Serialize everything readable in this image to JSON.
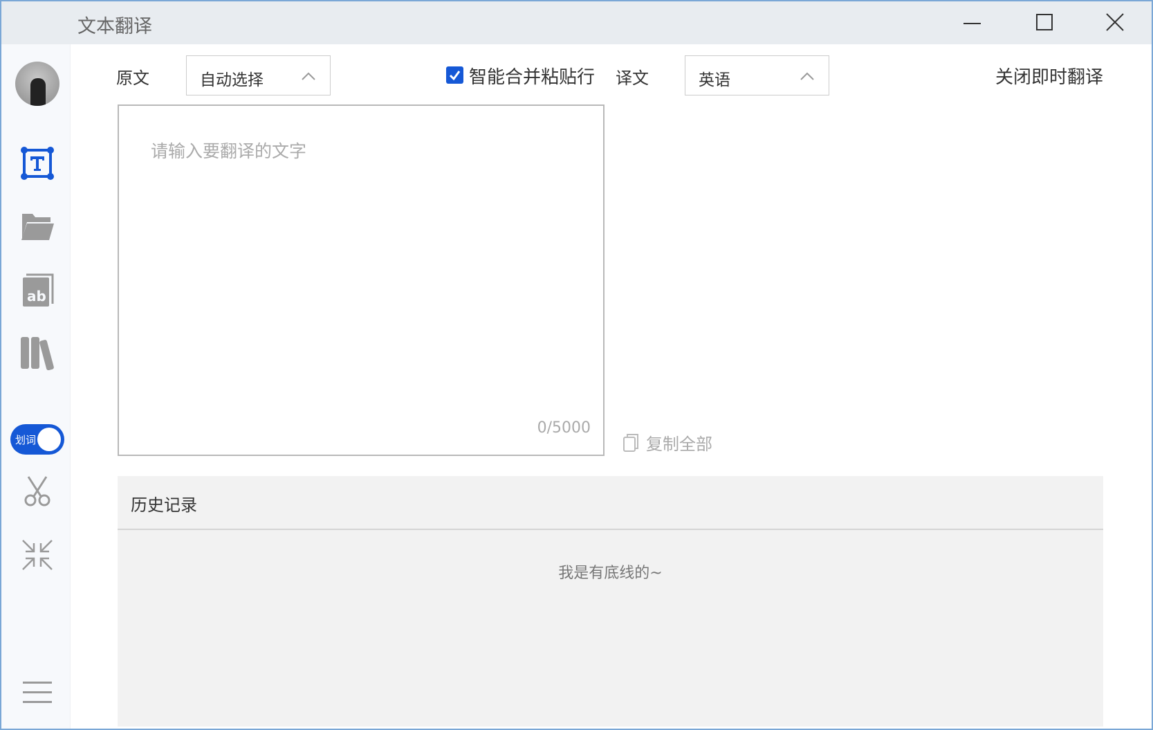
{
  "window": {
    "title": "文本翻译"
  },
  "sidebar": {
    "toggle_label": "划词",
    "toggle_on": true
  },
  "toolbar": {
    "source_label": "原文",
    "source_lang": "自动选择",
    "merge_label": "智能合并粘贴行",
    "merge_checked": true,
    "target_label": "译文",
    "target_lang": "英语",
    "close_instant": "关闭即时翻译"
  },
  "input": {
    "placeholder": "请输入要翻译的文字",
    "value": "",
    "count": "0/5000"
  },
  "output": {
    "copy_all": "复制全部"
  },
  "history": {
    "title": "历史记录",
    "end_text": "我是有底线的~"
  },
  "colors": {
    "accent": "#1558d6",
    "titlebar": "#e8ecf0",
    "sidebar": "#f7f9fc",
    "history_bg": "#f2f2f2"
  }
}
